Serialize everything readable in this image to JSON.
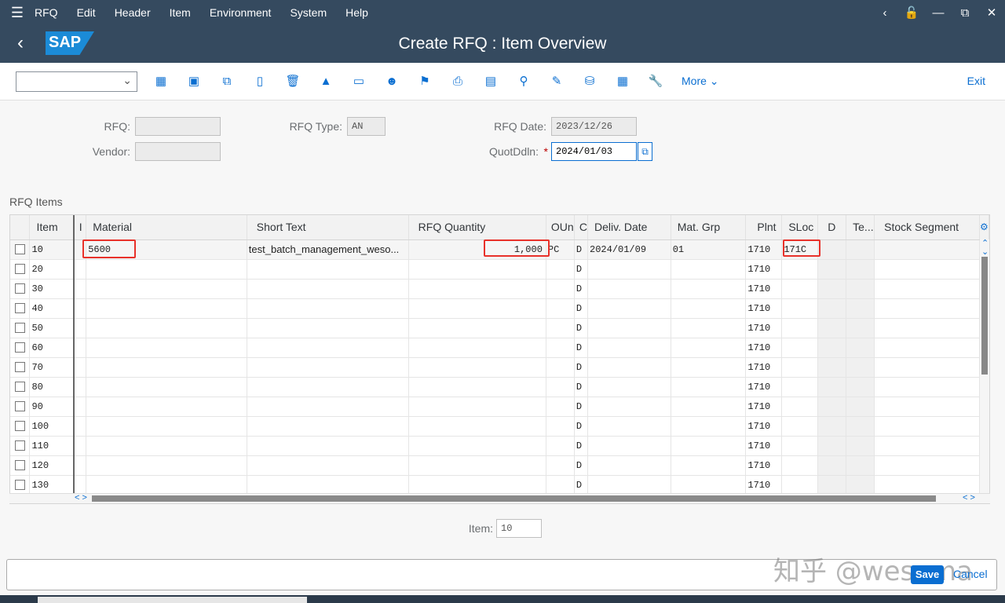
{
  "menu": {
    "items": [
      "RFQ",
      "Edit",
      "Header",
      "Item",
      "Environment",
      "System",
      "Help"
    ]
  },
  "title": "Create RFQ : Item Overview",
  "logo": "SAP",
  "toolbar": {
    "more": "More",
    "exit": "Exit",
    "icons": [
      "select-all-icon",
      "deselect-icon",
      "copy-icon",
      "document-icon",
      "delete-icon",
      "hat-icon",
      "card-icon",
      "partners-icon",
      "flag-icon",
      "print-icon",
      "chart-icon",
      "search-icon",
      "edit-icon",
      "truck-icon",
      "calendar-icon",
      "wrench-icon"
    ]
  },
  "header": {
    "rfq_label": "RFQ:",
    "rfq_value": "",
    "vendor_label": "Vendor:",
    "vendor_value": "",
    "type_label": "RFQ Type:",
    "type_value": "AN",
    "date_label": "RFQ Date:",
    "date_value": "2023/12/26",
    "deadline_label": "QuotDdln:",
    "deadline_required": "*",
    "deadline_value": "2024/01/03"
  },
  "items_title": "RFQ Items",
  "table": {
    "columns": [
      "Item",
      "I",
      "Material",
      "Short Text",
      "RFQ Quantity",
      "OUn",
      "C",
      "Deliv. Date",
      "Mat. Grp",
      "Plnt",
      "SLoc",
      "D",
      "Te...",
      "Stock Segment"
    ],
    "rows": [
      [
        "10",
        "",
        "5600",
        "test_batch_management_weso...",
        "1,000",
        "PC",
        "D",
        "2024/01/09",
        "01",
        "1710",
        "171C",
        "",
        "",
        ""
      ],
      [
        "20",
        "",
        "",
        "",
        "",
        "",
        "D",
        "",
        "",
        "1710",
        "",
        "",
        "",
        ""
      ],
      [
        "30",
        "",
        "",
        "",
        "",
        "",
        "D",
        "",
        "",
        "1710",
        "",
        "",
        "",
        ""
      ],
      [
        "40",
        "",
        "",
        "",
        "",
        "",
        "D",
        "",
        "",
        "1710",
        "",
        "",
        "",
        ""
      ],
      [
        "50",
        "",
        "",
        "",
        "",
        "",
        "D",
        "",
        "",
        "1710",
        "",
        "",
        "",
        ""
      ],
      [
        "60",
        "",
        "",
        "",
        "",
        "",
        "D",
        "",
        "",
        "1710",
        "",
        "",
        "",
        ""
      ],
      [
        "70",
        "",
        "",
        "",
        "",
        "",
        "D",
        "",
        "",
        "1710",
        "",
        "",
        "",
        ""
      ],
      [
        "80",
        "",
        "",
        "",
        "",
        "",
        "D",
        "",
        "",
        "1710",
        "",
        "",
        "",
        ""
      ],
      [
        "90",
        "",
        "",
        "",
        "",
        "",
        "D",
        "",
        "",
        "1710",
        "",
        "",
        "",
        ""
      ],
      [
        "100",
        "",
        "",
        "",
        "",
        "",
        "D",
        "",
        "",
        "1710",
        "",
        "",
        "",
        ""
      ],
      [
        "110",
        "",
        "",
        "",
        "",
        "",
        "D",
        "",
        "",
        "1710",
        "",
        "",
        "",
        ""
      ],
      [
        "120",
        "",
        "",
        "",
        "",
        "",
        "D",
        "",
        "",
        "1710",
        "",
        "",
        "",
        ""
      ],
      [
        "130",
        "",
        "",
        "",
        "",
        "",
        "D",
        "",
        "",
        "1710",
        "",
        "",
        "",
        ""
      ]
    ]
  },
  "item_field": {
    "label": "Item:",
    "value": "10"
  },
  "footer": {
    "save": "Save",
    "cancel": "Cancel"
  },
  "watermark": "知乎 @wesoma"
}
